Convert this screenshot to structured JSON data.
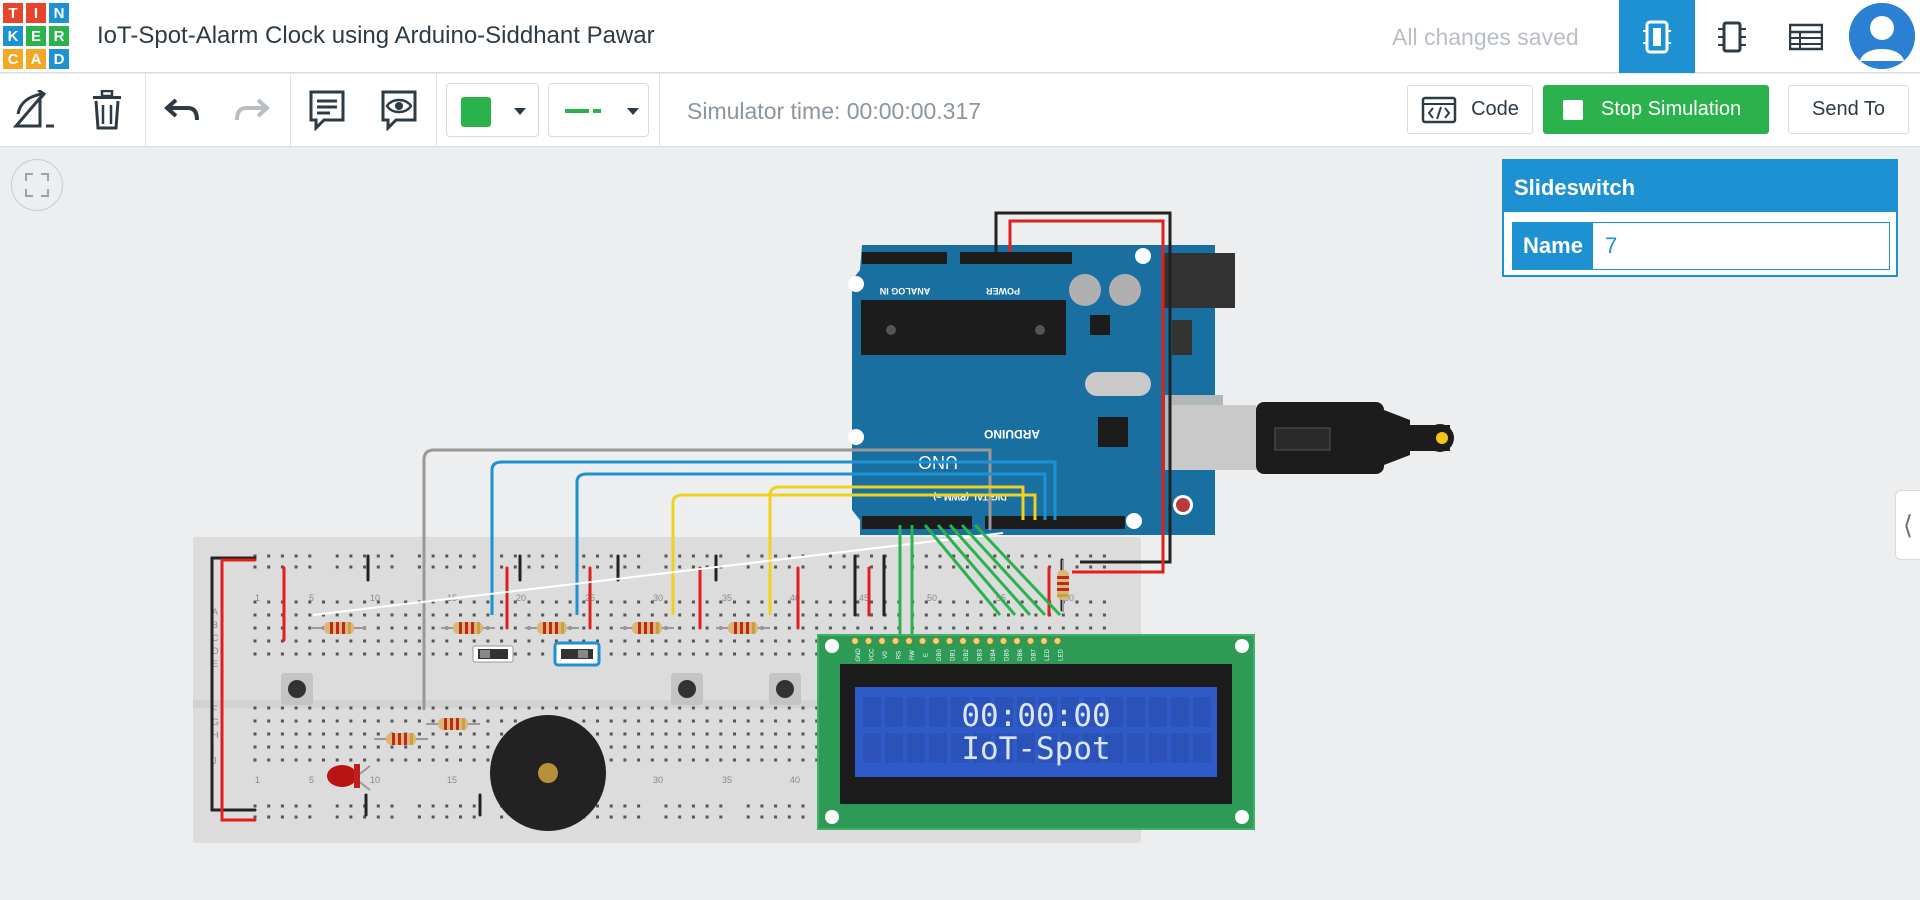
{
  "app": {
    "logo_letters": [
      "T",
      "I",
      "N",
      "K",
      "E",
      "R",
      "C",
      "A",
      "D"
    ],
    "logo_colors": [
      "#e8442b",
      "#e8442b",
      "#1d91d2",
      "#1d91d2",
      "#2bb24c",
      "#2bb24c",
      "#f5a623",
      "#f5a623",
      "#1d91d2"
    ],
    "project_title": "IoT-Spot-Alarm Clock using Arduino-Siddhant Pawar",
    "save_status": "All changes saved",
    "view_buttons": [
      "circuit-view-icon",
      "schematic-view-icon",
      "component-list-icon"
    ]
  },
  "toolbar": {
    "tools": [
      "rotate-icon",
      "delete-icon",
      "undo-icon",
      "redo-icon",
      "notes-icon",
      "toggle-notes-icon"
    ],
    "color_swatch": "#2bb24c",
    "wire_color": "#2bb24c",
    "simulator_time": "Simulator time: 00:00:00.317",
    "code_label": "Code",
    "stop_label": "Stop Simulation",
    "send_label": "Send To"
  },
  "inspector": {
    "component": "Slideswitch",
    "name_label": "Name",
    "name_value": "7"
  },
  "circuit": {
    "lcd_line1": "00:00:00",
    "lcd_line2": "IoT-Spot",
    "arduino_label": "ARDUINO",
    "arduino_model": "UNO",
    "power_header": "POWER",
    "analog_header": "ANALOG IN",
    "digital_header": "DIGITAL (PWM ~)",
    "breadboard_numbers": [
      "1",
      "5",
      "10",
      "15",
      "20",
      "25",
      "30",
      "35",
      "40",
      "45",
      "50",
      "55",
      "60"
    ],
    "breadboard_rows_top": [
      "A",
      "B",
      "C",
      "D",
      "E"
    ],
    "breadboard_rows_bottom": [
      "F",
      "G",
      "H",
      "I",
      "J"
    ],
    "lcd_pins": [
      "GND",
      "VCC",
      "V0",
      "RS",
      "RW",
      "E",
      "DB0",
      "DB1",
      "DB2",
      "DB3",
      "DB4",
      "DB5",
      "DB6",
      "DB7",
      "LED",
      "LED"
    ]
  }
}
